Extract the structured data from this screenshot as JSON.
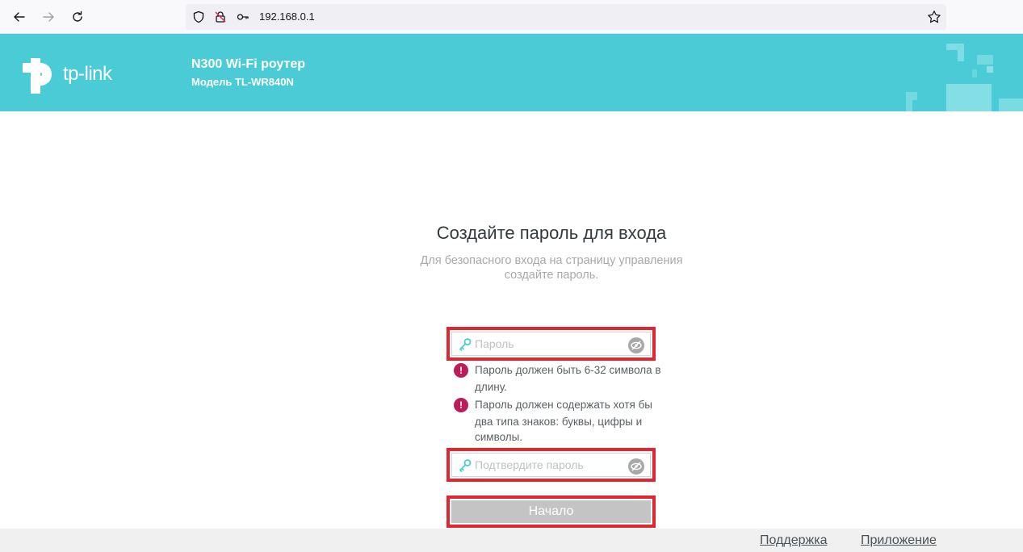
{
  "browser": {
    "url": "192.168.0.1",
    "icons": [
      "back-arrow-icon",
      "forward-arrow-icon",
      "reload-icon",
      "shield-icon",
      "insecure-lock-icon",
      "key-icon",
      "star-icon"
    ]
  },
  "header": {
    "logo_text": "tp-link",
    "model_title": "N300 Wi-Fi роутер",
    "model_subtitle": "Модель TL-WR840N",
    "color": "#4acbd6"
  },
  "main": {
    "title": "Создайте пароль для входа",
    "subtitle_line1": "Для безопасного входа на страницу управления",
    "subtitle_line2": "создайте пароль.",
    "password_placeholder": "Пароль",
    "confirm_placeholder": "Подтвердите пароль",
    "tips": [
      {
        "line1": "Пароль должен быть 6-32 символа в",
        "line2": "длину."
      },
      {
        "line1": "Пароль должен содержать хотя бы",
        "line2": "два типа знаков: буквы, цифры и",
        "line3": "символы."
      }
    ],
    "start_label": "Начало",
    "highlight_color": "#e3252f",
    "tip_icon_color": "#bb1d5a"
  },
  "footer": {
    "support_label": "Поддержка",
    "app_label": "Приложение"
  }
}
